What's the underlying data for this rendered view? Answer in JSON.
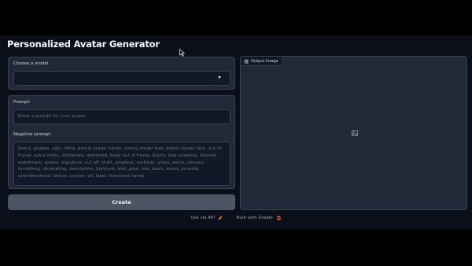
{
  "app": {
    "title": "Personalized Avatar Generator"
  },
  "model": {
    "label": "Choose a model",
    "selected": ""
  },
  "prompt": {
    "label": "Prompt:",
    "placeholder": "Enter a prompt for your avatar"
  },
  "negative_prompt": {
    "label": "Negative prompt:",
    "value": "beard, goatee, ugly, tiling, poorly drawn hands, poorly drawn feet, poorly drawn face, out of frame, extra limbs, disfigured, deformed, body out of frame, blurry, bad anatomy, blurred, watermark, grainy, signature, cut off, draft, amateur, multiple, gross, weird, uneven, furnishing, decorating, decoration, furniture, text, poor, low, basic, worst, juvenile, unprofessional, failure, crayon, oil, label, thousand hands"
  },
  "actions": {
    "create_label": "Create"
  },
  "output": {
    "label": "Output Image"
  },
  "footer": {
    "api_label": "Use via API",
    "separator": "·",
    "built_label": "Built with Gradio"
  },
  "icons": {
    "dropdown": "chevron-down-icon",
    "output_tag": "image-grid-icon",
    "placeholder": "image-icon",
    "api": "rocket-icon",
    "gradio": "gradio-logo-icon"
  },
  "colors": {
    "background": "#0b0f19",
    "panel": "#1f2937",
    "input": "#111827",
    "button": "#4b5563",
    "accent": "#f97316"
  }
}
